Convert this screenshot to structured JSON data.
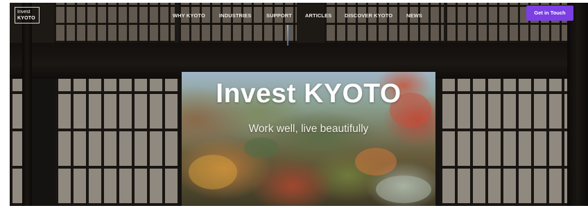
{
  "logo": {
    "line1": "Invest",
    "line2": "KYOTO"
  },
  "nav": {
    "items": [
      {
        "label": "WHY KYOTO"
      },
      {
        "label": "INDUSTRIES"
      },
      {
        "label": "SUPPORT"
      },
      {
        "label": "ARTICLES"
      },
      {
        "label": "DISCOVER KYOTO"
      },
      {
        "label": "NEWS"
      }
    ],
    "active_label": "ARTICLES"
  },
  "cta": {
    "label": "Get in Touch"
  },
  "hero": {
    "title": "Invest KYOTO",
    "subtitle": "Work well, live beautifully"
  },
  "colors": {
    "accent": "#7b3fe4",
    "background": "#151311",
    "nav_text": "#f1eee8"
  }
}
